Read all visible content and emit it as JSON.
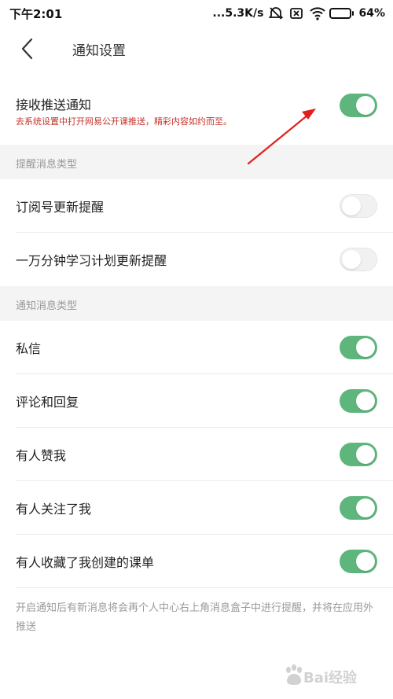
{
  "status_bar": {
    "time": "下午2:01",
    "network_speed": "...5.3K/s",
    "battery_percent": "64%",
    "battery_level": 0.64
  },
  "header": {
    "title": "通知设置",
    "back_icon": "chevron-left-icon"
  },
  "push": {
    "label": "接收推送通知",
    "subtitle": "去系统设置中打开网易公开课推送，精彩内容如约而至。",
    "enabled": true
  },
  "sections": {
    "reminder_title": "提醒消息类型",
    "notify_title": "通知消息类型"
  },
  "reminder_items": [
    {
      "label": "订阅号更新提醒",
      "enabled": false
    },
    {
      "label": "一万分钟学习计划更新提醒",
      "enabled": false
    }
  ],
  "notify_items": [
    {
      "label": "私信",
      "enabled": true
    },
    {
      "label": "评论和回复",
      "enabled": true
    },
    {
      "label": "有人赞我",
      "enabled": true
    },
    {
      "label": "有人关注了我",
      "enabled": true
    },
    {
      "label": "有人收藏了我创建的课单",
      "enabled": true
    }
  ],
  "footer_note": "开启通知后有新消息将会再个人中心右上角消息盒子中进行提醒，并将在应用外推送",
  "watermark": {
    "text": "Bai经验"
  },
  "colors": {
    "toggle_on": "#5fb67d",
    "toggle_off": "#f1f1f1",
    "warning_text": "#c4332b",
    "annotation_arrow": "#e02020",
    "section_background": "#f4f4f4"
  }
}
